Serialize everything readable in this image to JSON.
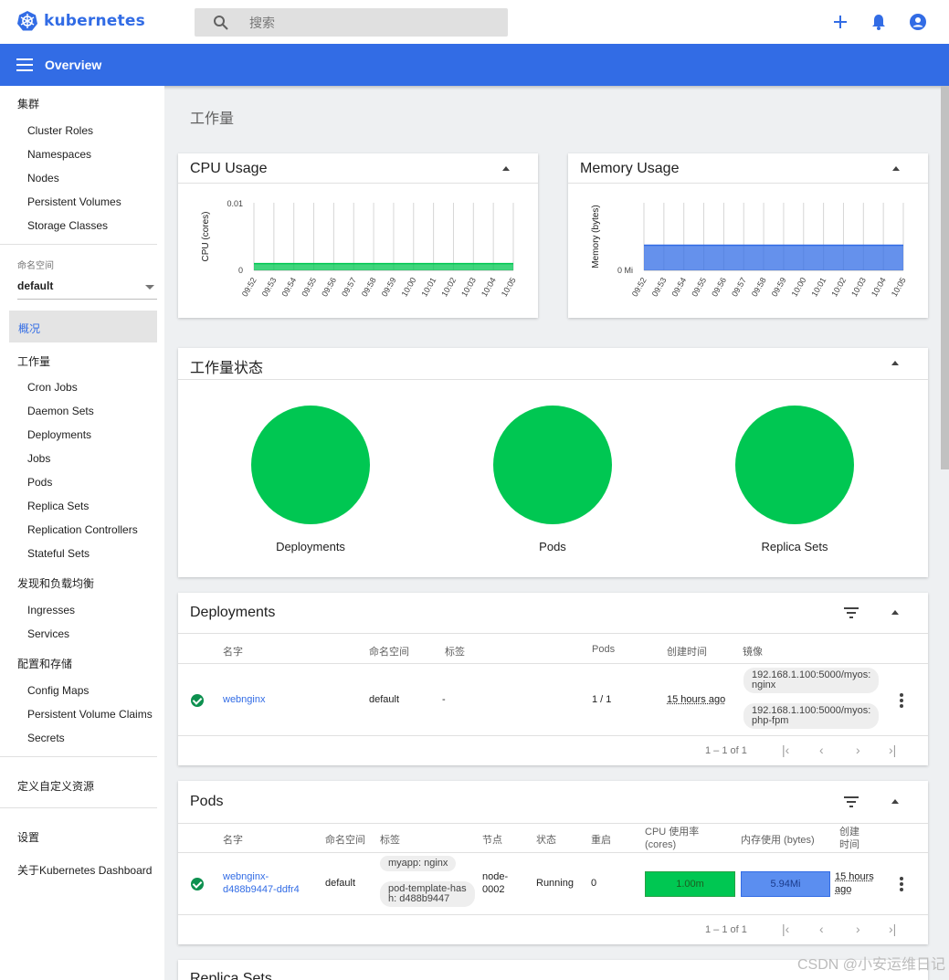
{
  "topbar": {
    "logo_text": "kubernetes",
    "search_placeholder": "搜索"
  },
  "header": {
    "title": "Overview"
  },
  "sidebar": {
    "cluster_heading": "集群",
    "cluster_items": [
      "Cluster Roles",
      "Namespaces",
      "Nodes",
      "Persistent Volumes",
      "Storage Classes"
    ],
    "namespace_label": "命名空间",
    "namespace_value": "default",
    "overview": "概况",
    "workloads_heading": "工作量",
    "workload_items": [
      "Cron Jobs",
      "Daemon Sets",
      "Deployments",
      "Jobs",
      "Pods",
      "Replica Sets",
      "Replication Controllers",
      "Stateful Sets"
    ],
    "discovery_heading": "发现和负载均衡",
    "discovery_items": [
      "Ingresses",
      "Services"
    ],
    "config_heading": "配置和存储",
    "config_items": [
      "Config Maps",
      "Persistent Volume Claims",
      "Secrets"
    ],
    "crd": "定义自定义资源",
    "settings": "设置",
    "about": "关于Kubernetes Dashboard"
  },
  "main": {
    "page_title": "工作量",
    "cpu_card_title": "CPU Usage",
    "memory_card_title": "Memory Usage",
    "status_card_title": "工作量状态",
    "status_items": [
      "Deployments",
      "Pods",
      "Replica Sets"
    ],
    "status_color": "#00c752"
  },
  "chart_data": [
    {
      "type": "area",
      "title": "CPU Usage",
      "ylabel": "CPU (cores)",
      "y_ticks": [
        "0.01",
        "0"
      ],
      "x": [
        "09:52",
        "09:53",
        "09:54",
        "09:55",
        "09:56",
        "09:57",
        "09:58",
        "09:59",
        "10:00",
        "10:01",
        "10:02",
        "10:03",
        "10:04",
        "10:05"
      ],
      "values": [
        0.001,
        0.001,
        0.001,
        0.001,
        0.001,
        0.001,
        0.001,
        0.001,
        0.001,
        0.001,
        0.001,
        0.001,
        0.001,
        0.001
      ],
      "ylim": [
        0,
        0.01
      ],
      "color": "#00c752"
    },
    {
      "type": "area",
      "title": "Memory Usage",
      "ylabel": "Memory (bytes)",
      "y_ticks": [
        "0 Mi"
      ],
      "x": [
        "09:52",
        "09:53",
        "09:54",
        "09:55",
        "09:56",
        "09:57",
        "09:58",
        "09:59",
        "10:00",
        "10:01",
        "10:02",
        "10:03",
        "10:04",
        "10:05"
      ],
      "values": [
        5.94,
        5.94,
        5.94,
        5.94,
        5.94,
        5.94,
        5.94,
        5.94,
        5.94,
        5.94,
        5.94,
        5.94,
        5.94,
        5.94
      ],
      "ylim": [
        0,
        16
      ],
      "color": "#326ce5"
    }
  ],
  "deployments": {
    "title": "Deployments",
    "headers": [
      "名字",
      "命名空间",
      "标签",
      "Pods",
      "创建时间",
      "镜像"
    ],
    "row": {
      "name": "webnginx",
      "namespace": "default",
      "labels": "-",
      "pods": "1 / 1",
      "created": "15 hours ago",
      "image1": "192.168.1.100:5000/myos:\nnginx",
      "image2": "192.168.1.100:5000/myos:\nphp-fpm"
    },
    "pager": "1 – 1 of 1"
  },
  "pods": {
    "title": "Pods",
    "headers": [
      "名字",
      "命名空间",
      "标签",
      "节点",
      "状态",
      "重启",
      "CPU 使用率\n(cores)",
      "内存使用 (bytes)",
      "创建\n时间"
    ],
    "row": {
      "name": "webnginx-\nd488b9447-ddfr4",
      "namespace": "default",
      "label1": "myapp: nginx",
      "label2": "pod-template-has\nh: d488b9447",
      "node": "node-\n0002",
      "status": "Running",
      "restarts": "0",
      "cpu": "1.00m",
      "memory": "5.94Mi",
      "created": "15 hours\nago"
    },
    "pager": "1 – 1 of 1"
  },
  "next_card_title": "Replica Sets",
  "watermark": "CSDN @小安运维日记"
}
